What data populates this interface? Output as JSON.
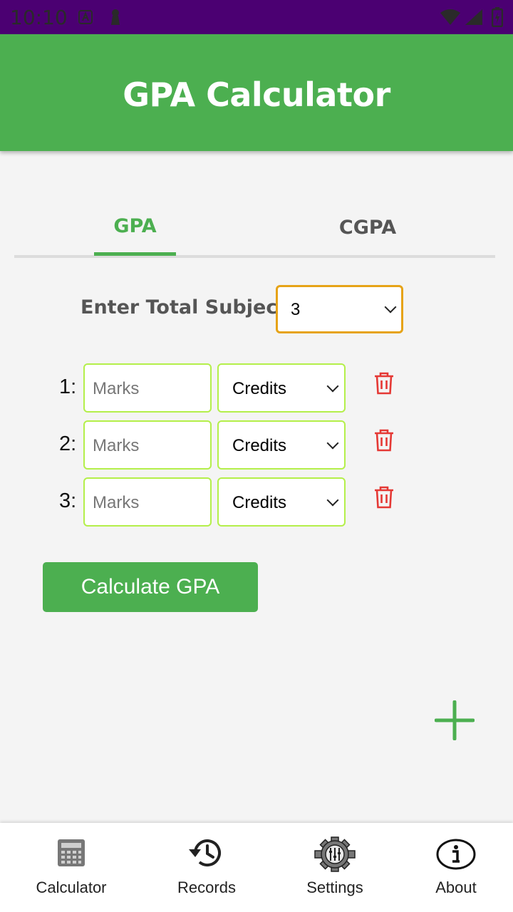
{
  "status_bar": {
    "time": "10:10",
    "icons": [
      "notification-a-icon",
      "keyhole-icon",
      "wifi-icon",
      "signal-icon",
      "battery-icon"
    ]
  },
  "app_bar": {
    "title": "GPA Calculator"
  },
  "tabs": [
    {
      "label": "GPA",
      "active": true
    },
    {
      "label": "CGPA",
      "active": false
    }
  ],
  "total_subjects": {
    "label": "Enter Total Subjects:",
    "value": "3"
  },
  "subjects": [
    {
      "index": "1:",
      "marks_placeholder": "Marks",
      "credits_value": "Credits"
    },
    {
      "index": "2:",
      "marks_placeholder": "Marks",
      "credits_value": "Credits"
    },
    {
      "index": "3:",
      "marks_placeholder": "Marks",
      "credits_value": "Credits"
    }
  ],
  "calculate_button": {
    "label": "Calculate GPA"
  },
  "bottom_nav": [
    {
      "label": "Calculator",
      "icon": "calculator-icon"
    },
    {
      "label": "Records",
      "icon": "history-icon"
    },
    {
      "label": "Settings",
      "icon": "settings-gear-icon"
    },
    {
      "label": "About",
      "icon": "info-icon"
    }
  ],
  "colors": {
    "primary": "#4caf50",
    "status_bar": "#4b0072",
    "select_focus": "#e6a317",
    "field_border": "#b4ef4a",
    "delete": "#e53935"
  }
}
